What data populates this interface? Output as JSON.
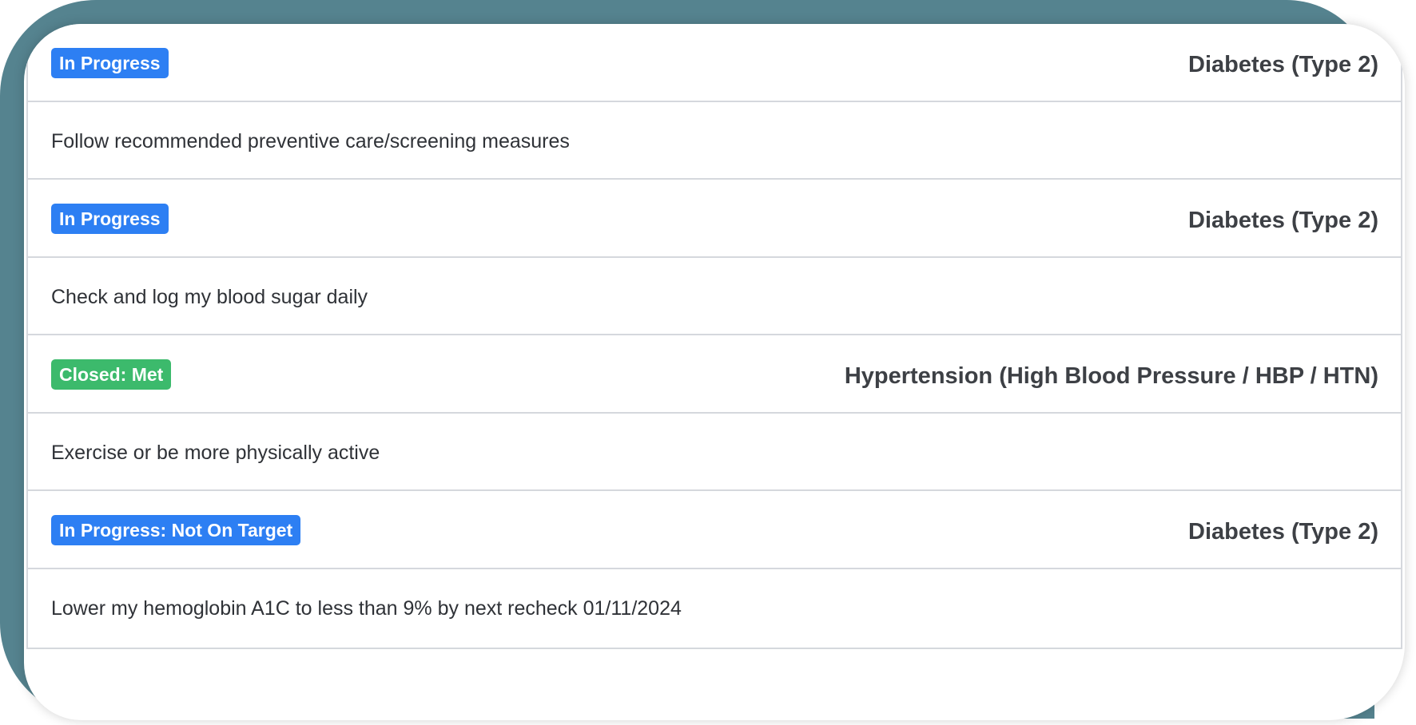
{
  "colors": {
    "frame": "#55838f",
    "in_progress": "#2d7ff3",
    "closed_met": "#3cba6c",
    "card_border": "#d5d8dd"
  },
  "goals": [
    {
      "status": "In Progress",
      "status_color": "#2d7ff3",
      "condition": "Diabetes (Type 2)",
      "description": "Follow recommended preventive care/screening measures"
    },
    {
      "status": "In Progress",
      "status_color": "#2d7ff3",
      "condition": "Diabetes (Type 2)",
      "description": "Check and log my blood sugar daily"
    },
    {
      "status": "Closed: Met",
      "status_color": "#3cba6c",
      "condition": "Hypertension (High Blood Pressure / HBP / HTN)",
      "description": "Exercise or be more physically active"
    },
    {
      "status": "In Progress: Not On Target",
      "status_color": "#2d7ff3",
      "condition": "Diabetes (Type 2)",
      "description": "Lower my hemoglobin A1C to less than 9% by next recheck 01/11/2024"
    }
  ]
}
